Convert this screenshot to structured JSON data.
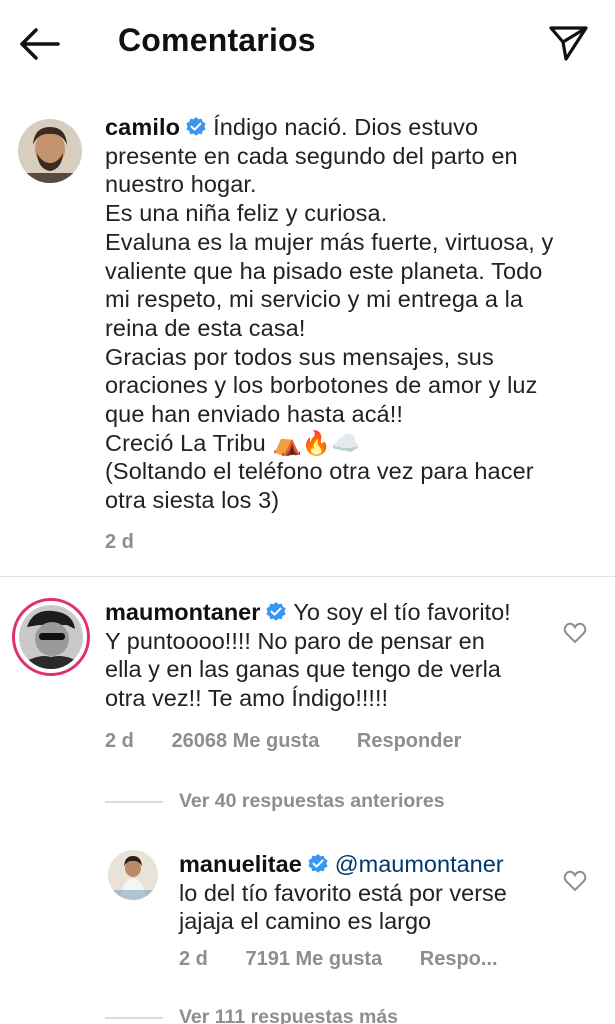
{
  "header": {
    "title": "Comentarios"
  },
  "caption": {
    "username": "camilo",
    "text": "Índigo nació. Dios estuvo\npresente en cada segundo del parto en\nnuestro hogar.\nEs una niña feliz y curiosa.\nEvaluna es la mujer más fuerte, virtuosa, y\nvaliente que ha pisado este planeta. Todo\nmi respeto, mi servicio y mi entrega a la\nreina de esta casa!\nGracias por todos sus mensajes, sus\noraciones y los borbotones de amor y luz\nque han enviado hasta acá!!\nCreció La Tribu ⛺🔥☁️\n(Soltando el teléfono otra vez para hacer\notra siesta los 3)",
    "time": "2 d"
  },
  "comments": [
    {
      "username": "maumontaner",
      "text": "Yo soy el tío favorito!\nY puntoooo!!!! No paro de pensar en\nella y en las ganas que tengo de verla\notra vez!! Te amo Índigo!!!!!",
      "time": "2 d",
      "likes": "26068 Me gusta",
      "reply": "Responder",
      "view_replies": "Ver 40 respuestas anteriores"
    }
  ],
  "reply": {
    "username": "manuelitae",
    "mention": "@maumontaner",
    "text_line1": "lo del tío favorito está por verse",
    "text_line2": "jajaja el camino es largo",
    "time": "2 d",
    "likes": "7191 Me gusta",
    "reply": "Respo..."
  },
  "more_replies": "Ver 111 respuestas más",
  "colors": {
    "verified": "#3897f0",
    "story_ring": "#e1306c",
    "secondary_text": "#8e8e8e"
  }
}
